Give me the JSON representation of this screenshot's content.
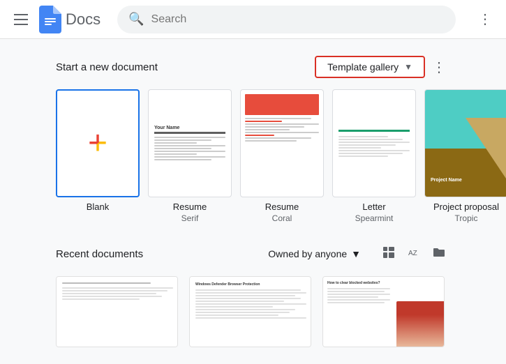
{
  "header": {
    "app_name": "Docs",
    "search_placeholder": "Search",
    "more_options_label": "⋮"
  },
  "new_doc_section": {
    "title": "Start a new document",
    "template_gallery_label": "Template gallery",
    "more_btn_label": "⋮"
  },
  "templates": [
    {
      "id": "blank",
      "label": "Blank",
      "sublabel": ""
    },
    {
      "id": "resume-serif",
      "label": "Resume",
      "sublabel": "Serif"
    },
    {
      "id": "resume-coral",
      "label": "Resume",
      "sublabel": "Coral"
    },
    {
      "id": "letter-spearmint",
      "label": "Letter",
      "sublabel": "Spearmint"
    },
    {
      "id": "project-proposal-tropic",
      "label": "Project proposal",
      "sublabel": "Tropic"
    }
  ],
  "recent_section": {
    "title": "Recent documents",
    "owned_by_label": "Owned by anyone",
    "sort_icon": "A↓Z",
    "view_grid_icon": "⊞",
    "view_folder_icon": "▭"
  },
  "recent_docs": [
    {
      "id": "doc1",
      "title": ""
    },
    {
      "id": "doc2",
      "title": "Windows Defender Browser Protection"
    },
    {
      "id": "doc3",
      "title": "How to clear blocked websites?"
    }
  ]
}
